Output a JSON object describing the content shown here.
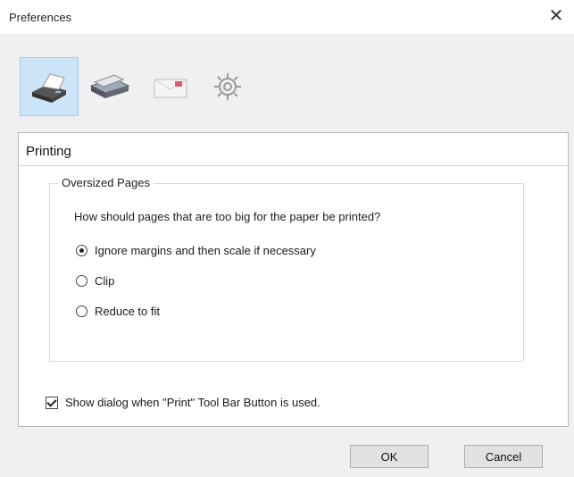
{
  "window": {
    "title": "Preferences",
    "close_glyph": "✕"
  },
  "toolbar": {
    "buttons": [
      {
        "icon": "printer-icon",
        "selected": true
      },
      {
        "icon": "scanner-icon",
        "selected": false
      },
      {
        "icon": "email-icon",
        "selected": false
      },
      {
        "icon": "gear-icon",
        "selected": false
      }
    ]
  },
  "panel": {
    "title": "Printing",
    "group": {
      "title": "Oversized Pages",
      "question": "How should pages that are too big for the paper be printed?",
      "options": [
        {
          "label": "Ignore margins and then scale if necessary",
          "checked": true
        },
        {
          "label": "Clip",
          "checked": false
        },
        {
          "label": "Reduce to fit",
          "checked": false
        }
      ]
    },
    "checkbox": {
      "label": "Show dialog when \"Print\" Tool Bar Button is used.",
      "checked": true
    }
  },
  "buttons": {
    "ok": "OK",
    "cancel": "Cancel"
  },
  "colors": {
    "selected_tab_bg": "#cce4f7",
    "panel_bg": "#ffffff",
    "window_bg": "#f0f0f0"
  }
}
